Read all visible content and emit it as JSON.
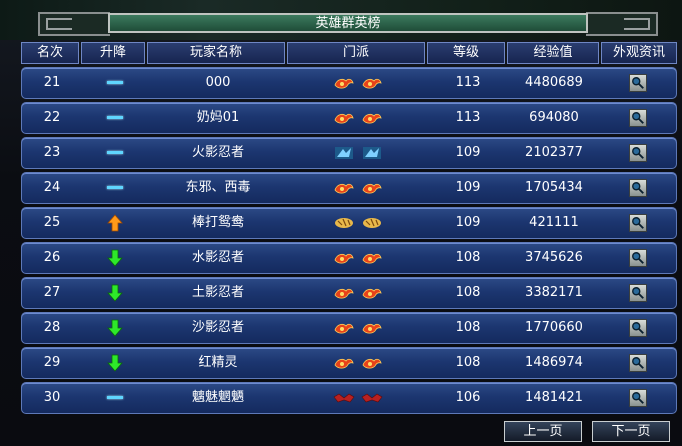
{
  "title": "英雄群英榜",
  "columns": {
    "rank": "名次",
    "change": "升降",
    "name": "玩家名称",
    "sect": "门派",
    "level": "等级",
    "exp": "经验值",
    "look": "外观资讯"
  },
  "rows": [
    {
      "rank": "21",
      "change": "same",
      "name": "000",
      "sect": "fire",
      "level": "113",
      "exp": "4480689"
    },
    {
      "rank": "22",
      "change": "same",
      "name": "奶妈01",
      "sect": "fire",
      "level": "113",
      "exp": "694080"
    },
    {
      "rank": "23",
      "change": "same",
      "name": "火影忍者",
      "sect": "ice",
      "level": "109",
      "exp": "2102377"
    },
    {
      "rank": "24",
      "change": "same",
      "name": "东邪、西毒",
      "sect": "fire",
      "level": "109",
      "exp": "1705434"
    },
    {
      "rank": "25",
      "change": "up",
      "name": "棒打鸳鸯",
      "sect": "tiger",
      "level": "109",
      "exp": "421111"
    },
    {
      "rank": "26",
      "change": "down",
      "name": "水影忍者",
      "sect": "fire",
      "level": "108",
      "exp": "3745626"
    },
    {
      "rank": "27",
      "change": "down",
      "name": "土影忍者",
      "sect": "fire",
      "level": "108",
      "exp": "3382171"
    },
    {
      "rank": "28",
      "change": "down",
      "name": "沙影忍者",
      "sect": "fire",
      "level": "108",
      "exp": "1770660"
    },
    {
      "rank": "29",
      "change": "down",
      "name": "红精灵",
      "sect": "fire",
      "level": "108",
      "exp": "1486974"
    },
    {
      "rank": "30",
      "change": "same",
      "name": "魑魅魍魉",
      "sect": "bat",
      "level": "106",
      "exp": "1481421"
    }
  ],
  "pager": {
    "prev": "上一页",
    "next": "下一页"
  },
  "colors": {
    "row_top": "#2c4a86",
    "row_bottom": "#142a5e",
    "fire": "#e8421a",
    "ice": "#7fd0ff",
    "up": "#ff9a1a",
    "down": "#2ee82a"
  }
}
